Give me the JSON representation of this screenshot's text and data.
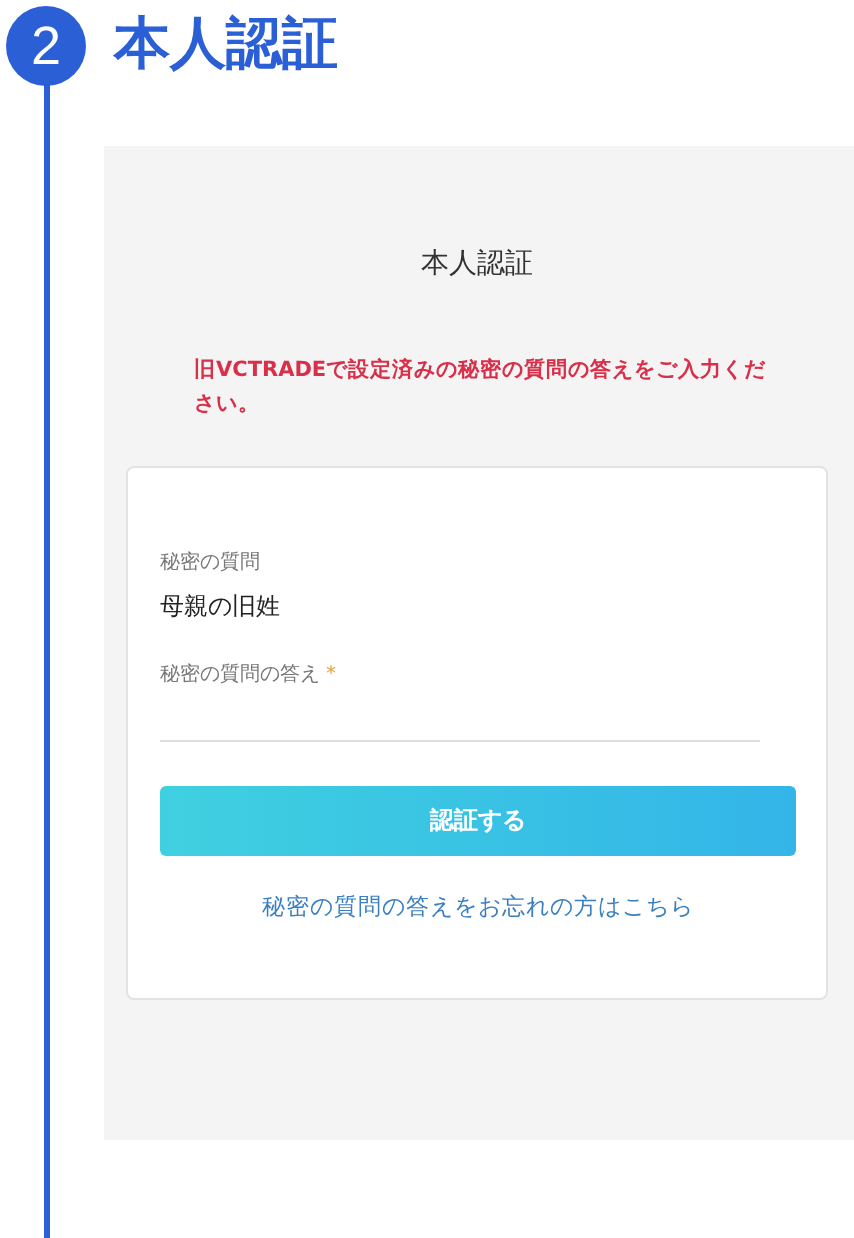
{
  "step": {
    "number": "2",
    "title": "本人認証"
  },
  "panel": {
    "title": "本人認証",
    "notice": "旧VCTRADEで設定済みの秘密の質問の答えをご入力ください。",
    "question": {
      "label": "秘密の質問",
      "value": "母親の旧姓"
    },
    "answer": {
      "label": "秘密の質問の答え",
      "required_mark": "*"
    },
    "submit": "認証する",
    "forgot_link": "秘密の質問の答えをお忘れの方はこちら"
  }
}
